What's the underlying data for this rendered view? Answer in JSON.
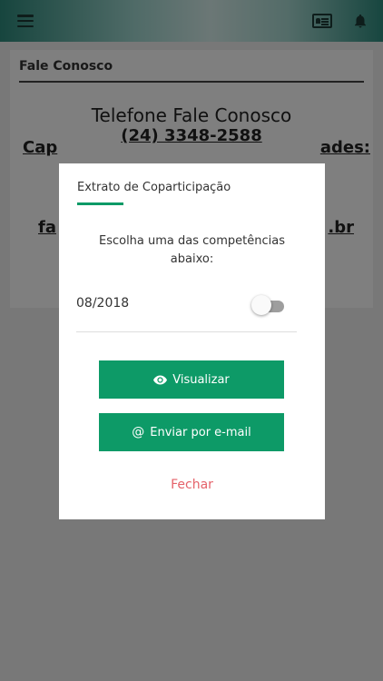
{
  "header": {
    "menu_icon": "hamburger-icon",
    "card_icon": "id-card-icon",
    "bell_icon": "bell-icon"
  },
  "card": {
    "title": "Fale Conosco",
    "phone_title": "Telefone Fale Conosco",
    "phone_number": "(24) 3348-2588",
    "capitais_left": "Cap",
    "capitais_right": "ades:",
    "email_left": "fa",
    "email_right": ".br"
  },
  "modal": {
    "title": "Extrato de Coparticipação",
    "description": "Escolha uma das competências abaixo:",
    "period": "08/2018",
    "toggle_on": false,
    "view_label": "Visualizar",
    "email_label": "Enviar por e-mail",
    "email_symbol": "@",
    "close_label": "Fechar"
  },
  "colors": {
    "accent": "#0d9a67",
    "close": "#e5626a",
    "overlay": "rgba(0,0,0,0.5)"
  }
}
